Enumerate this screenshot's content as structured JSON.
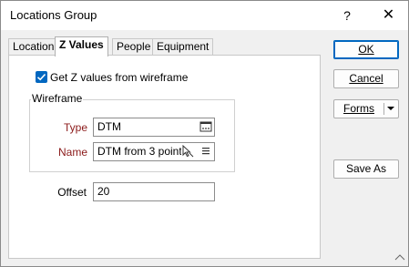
{
  "window": {
    "title": "Locations Group",
    "help_label": "?",
    "close_label": "✕"
  },
  "tabs": [
    {
      "label": "Location",
      "active": false
    },
    {
      "label": "Z Values",
      "active": true
    },
    {
      "label": "People",
      "active": false
    },
    {
      "label": "Equipment",
      "active": false
    }
  ],
  "zvalues": {
    "checkbox_label": "Get Z values from wireframe",
    "checkbox_checked": true,
    "wireframe_group_label": "Wireframe",
    "type_label": "Type",
    "type_value": "DTM",
    "name_label": "Name",
    "name_value": "DTM from 3 points",
    "offset_label": "Offset",
    "offset_value": "20"
  },
  "buttons": {
    "ok_label": "OK",
    "cancel_label": "Cancel",
    "forms_label": "Forms",
    "save_as_label": "Save As"
  },
  "icons": {
    "type_picker": "browse-icon",
    "name_pick": "pointer-icon",
    "name_list": "list-icon",
    "resize": "resize-grip-icon"
  },
  "colors": {
    "accent": "#0067c0",
    "required_label": "#8b1a1a"
  }
}
